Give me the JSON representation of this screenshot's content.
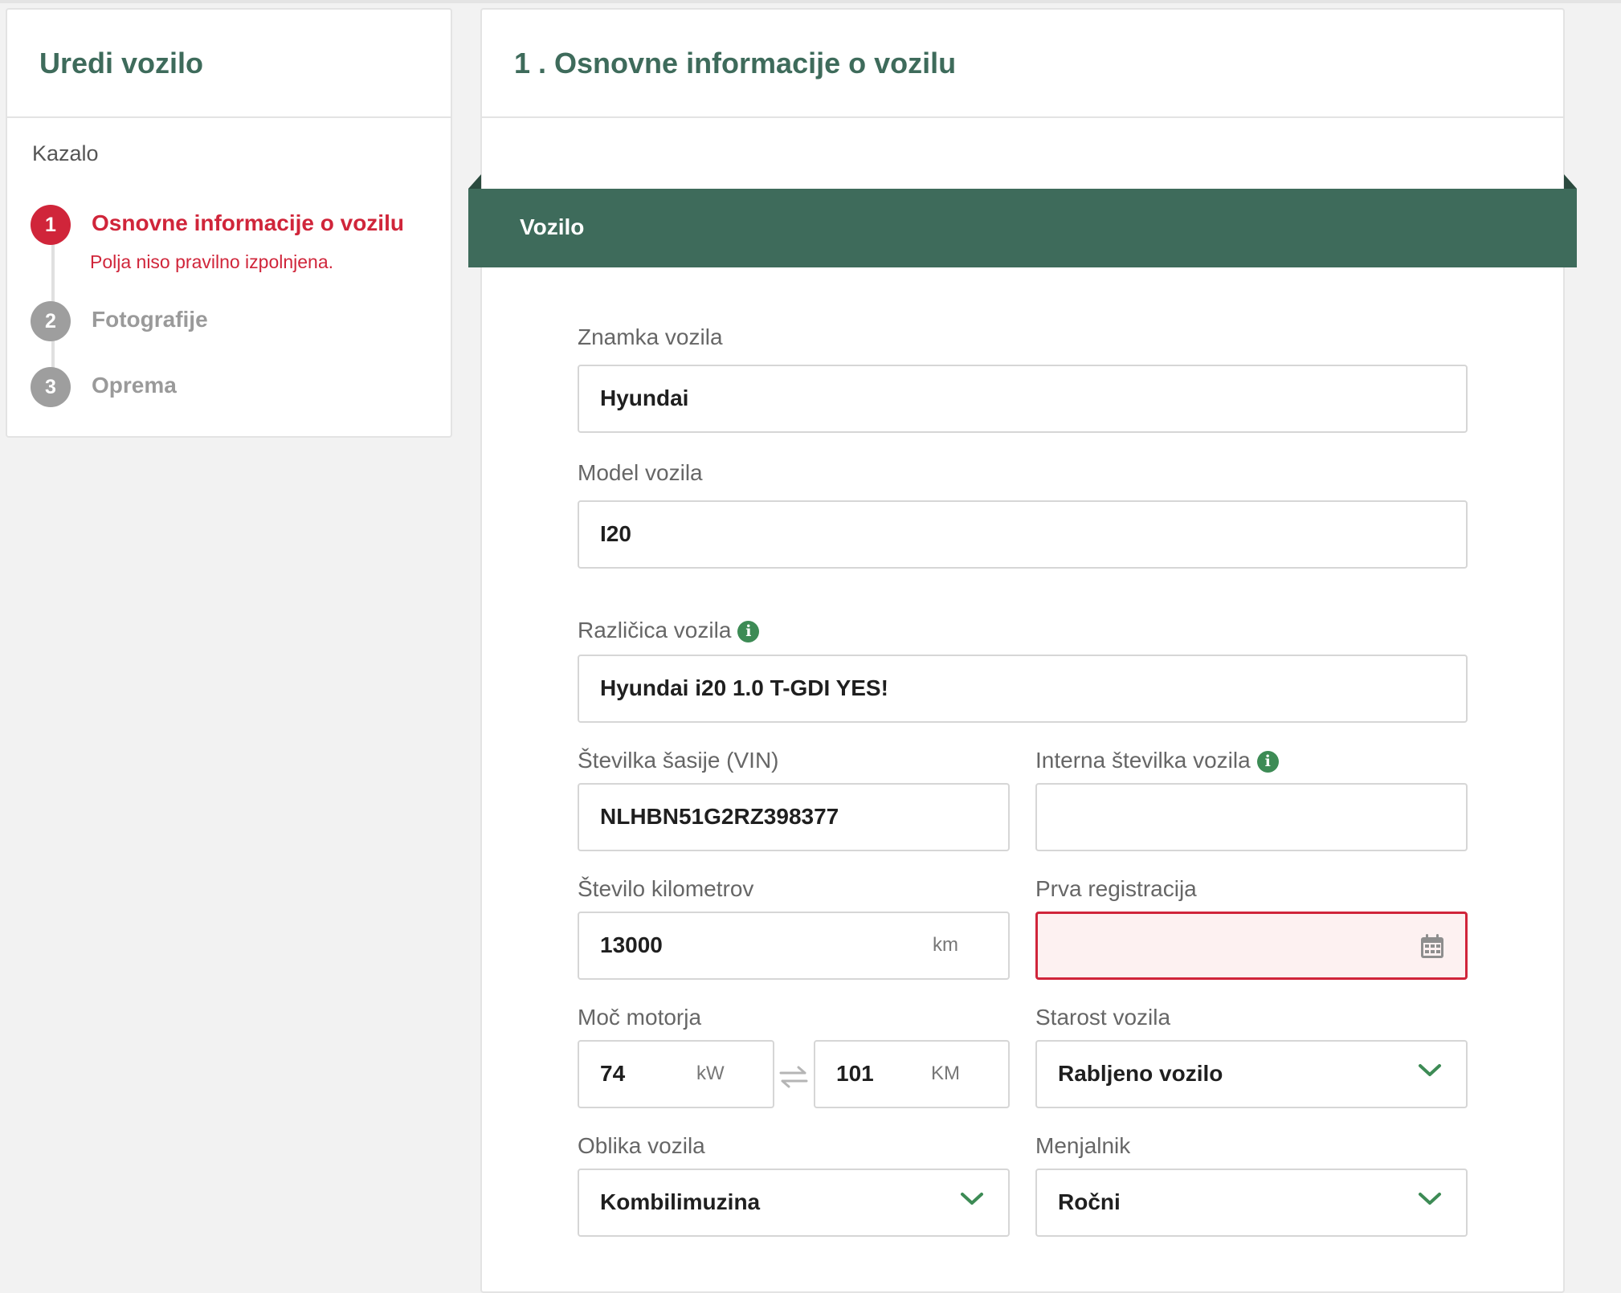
{
  "sidebar": {
    "title": "Uredi vozilo",
    "toc_label": "Kazalo",
    "steps": [
      {
        "number": "1",
        "label": "Osnovne informacije o vozilu",
        "error": "Polja niso pravilno izpolnjena.",
        "status": "error"
      },
      {
        "number": "2",
        "label": "Fotografije",
        "status": "inactive"
      },
      {
        "number": "3",
        "label": "Oprema",
        "status": "inactive"
      }
    ]
  },
  "main": {
    "title": "1 . Osnovne informacije o vozilu",
    "section": "Vozilo"
  },
  "form": {
    "brand": {
      "label": "Znamka vozila",
      "value": "Hyundai"
    },
    "model": {
      "label": "Model vozila",
      "value": "I20"
    },
    "variant": {
      "label": "Različica vozila",
      "value": "Hyundai i20 1.0 T-GDI YES!"
    },
    "vin": {
      "label": "Številka šasije (VIN)",
      "value": "NLHBN51G2RZ398377"
    },
    "internal_number": {
      "label": "Interna številka vozila",
      "value": ""
    },
    "mileage": {
      "label": "Število kilometrov",
      "value": "13000",
      "unit": "km"
    },
    "first_registration": {
      "label": "Prva registracija",
      "value": "",
      "state": "error"
    },
    "power": {
      "label": "Moč motorja",
      "kw_value": "74",
      "kw_unit": "kW",
      "hp_value": "101",
      "hp_unit": "KM"
    },
    "vehicle_age": {
      "label": "Starost vozila",
      "value": "Rabljeno vozilo"
    },
    "body_type": {
      "label": "Oblika vozila",
      "value": "Kombilimuzina"
    },
    "gearbox": {
      "label": "Menjalnik",
      "value": "Ročni"
    }
  },
  "icons": {
    "info": "info-icon",
    "dropdown": "chevron-down-icon",
    "calendar": "calendar-icon",
    "swap": "swap-arrows-icon"
  },
  "colors": {
    "brand_green": "#3e6b5b",
    "error_red": "#d0253a",
    "info_green": "#3d8b55"
  }
}
